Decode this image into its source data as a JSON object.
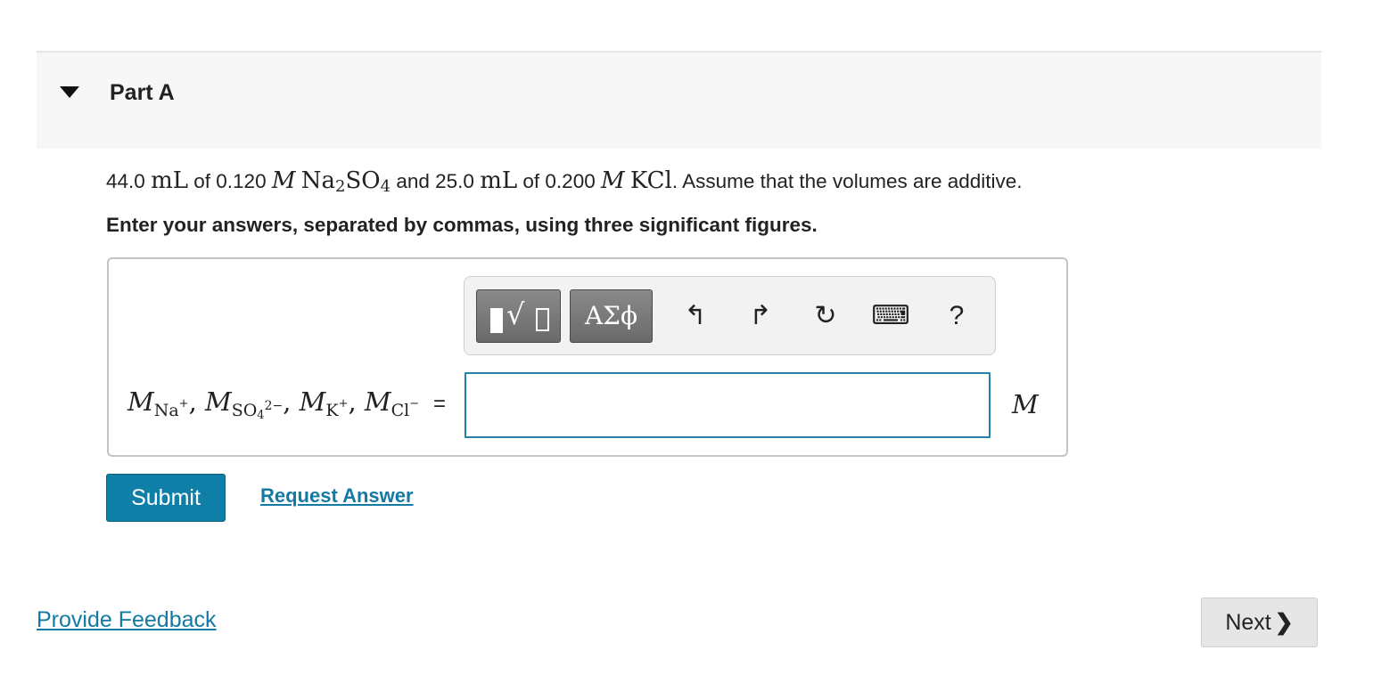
{
  "part": {
    "title": "Part A"
  },
  "prompt": {
    "v1": "44.0",
    "unit_ml": "mL",
    "of": "of",
    "c1": "0.120",
    "molar": "M",
    "na": "Na",
    "na_sub": "2",
    "so": "SO",
    "so_sub": "4",
    "and": "and",
    "v2": "25.0",
    "c2": "0.200",
    "kcl": "KCl",
    "tail": "Assume that the volumes are additive."
  },
  "instructions": "Enter your answers, separated by commas, using three significant figures.",
  "toolbar": {
    "greek_label": "ΑΣϕ",
    "undo_glyph": "↰",
    "redo_glyph": "↱",
    "reset_glyph": "↻",
    "keyboard_glyph": "⌨",
    "help_glyph": "?"
  },
  "answer": {
    "label": {
      "M": "M",
      "na": "Na",
      "plus": "+",
      "so": "SO",
      "so_sub": "4",
      "so_charge": "2−",
      "k": "K",
      "cl": "Cl",
      "minus": "−",
      "sep": ","
    },
    "equals": "=",
    "value": "",
    "unit": "M"
  },
  "actions": {
    "submit_label": "Submit",
    "request_label": "Request Answer"
  },
  "footer": {
    "feedback_label": "Provide Feedback",
    "next_label": "Next"
  }
}
